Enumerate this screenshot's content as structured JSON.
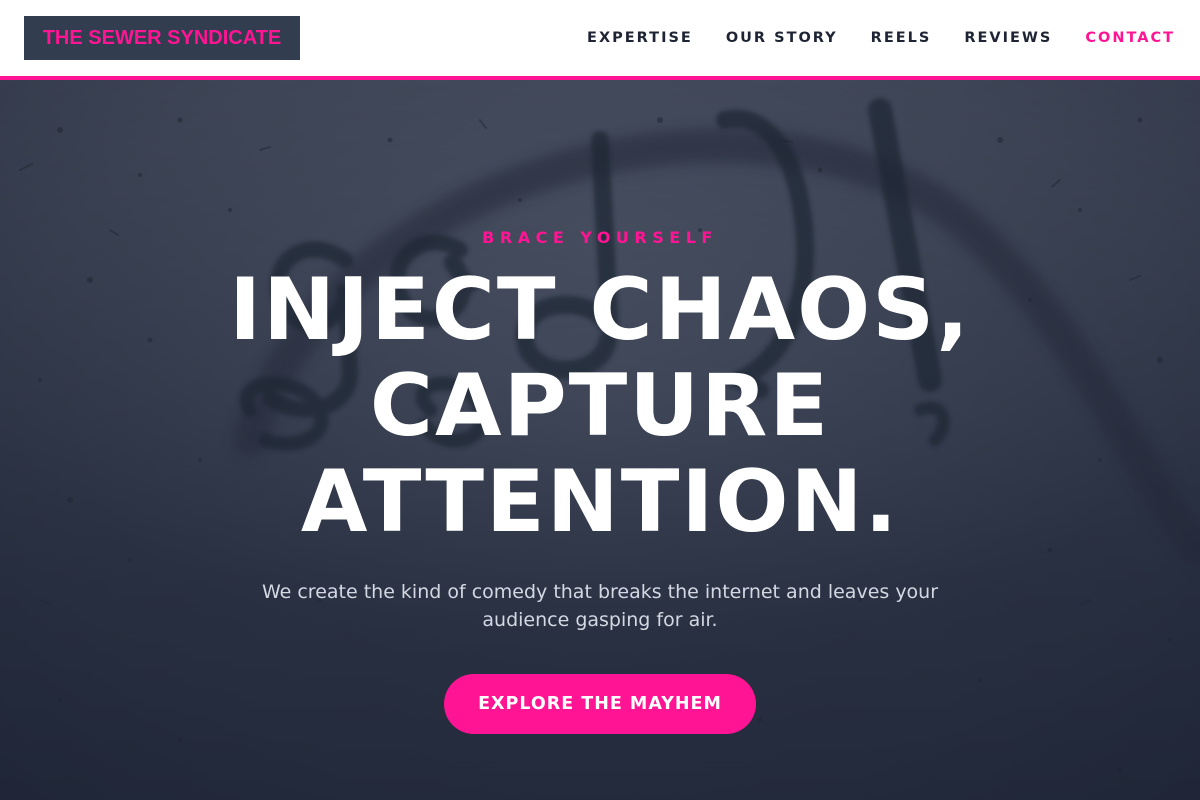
{
  "header": {
    "logo_text": "THE SEWER SYNDICATE",
    "nav": [
      {
        "label": "EXPERTISE"
      },
      {
        "label": "OUR STORY"
      },
      {
        "label": "REELS"
      },
      {
        "label": "REVIEWS"
      },
      {
        "label": "CONTACT"
      }
    ]
  },
  "hero": {
    "eyebrow": "BRACE YOURSELF",
    "headline_lines": [
      "INJECT CHAOS,",
      "CAPTURE",
      "ATTENTION."
    ],
    "subtext": "We create the kind of comedy that breaks the internet and leaves your audience gasping for air.",
    "cta_label": "EXPLORE THE MAYHEM"
  },
  "colors": {
    "accent": "#ff1493",
    "logo_background": "#333d50",
    "nav_text": "#1e2433",
    "hero_background": "#2b3344",
    "headline": "#ffffff",
    "subtext": "#d3d8e2"
  }
}
